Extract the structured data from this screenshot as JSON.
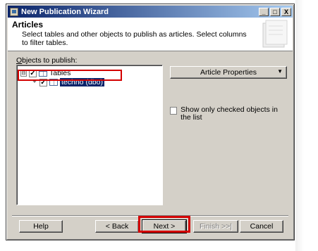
{
  "window": {
    "title": "New Publication Wizard",
    "controls": {
      "minimize": "_",
      "maximize": "□",
      "close": "X"
    }
  },
  "header": {
    "title": "Articles",
    "description": "Select tables and other objects to publish as articles. Select columns to filter tables."
  },
  "objects_label_prefix": "O",
  "objects_label_rest": "bjects to publish:",
  "tree": {
    "root": {
      "label": "Tables",
      "expander": "⊟",
      "checked": "✓",
      "icon": "table-icon"
    },
    "child": {
      "label": "techno (dbo)",
      "expander": "+",
      "checked": "✓",
      "icon": "table-icon"
    }
  },
  "article_properties": {
    "label": "Article Properties",
    "dropdown_icon": "▼"
  },
  "show_checked": {
    "label": "Show only checked objects in the list",
    "checked": ""
  },
  "buttons": {
    "help": "Help",
    "back": "< Back",
    "next": "Next >",
    "finish": "Finish >>|",
    "cancel": "Cancel"
  },
  "colors": {
    "highlight_red": "#d40000",
    "title_blue": "#0a246a",
    "window_gray": "#d4d0c8"
  }
}
